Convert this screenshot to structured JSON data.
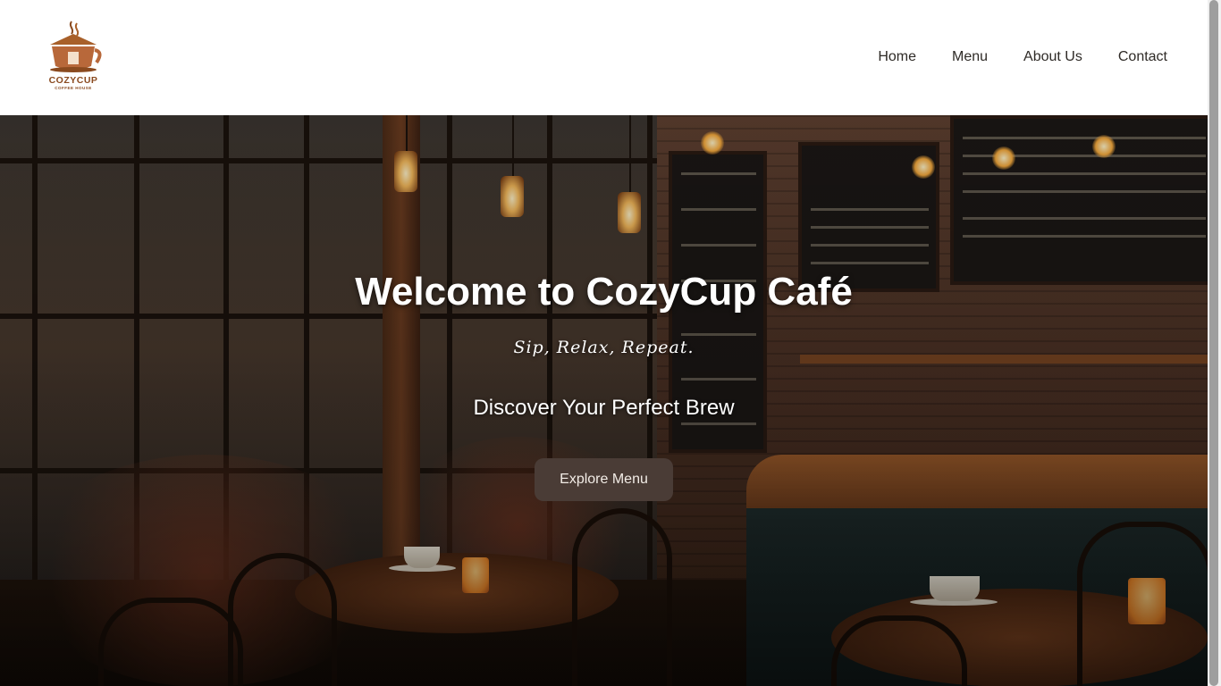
{
  "brand": {
    "name": "COZYCUP",
    "subtitle": "COFFEE HOUSE",
    "accent_color": "#8a4a1f",
    "icon": "coffee-cup-house-logo-icon"
  },
  "nav": {
    "items": [
      {
        "label": "Home"
      },
      {
        "label": "Menu"
      },
      {
        "label": "About Us"
      },
      {
        "label": "Contact"
      }
    ]
  },
  "hero": {
    "title": "Welcome to CozyCup Café",
    "tagline": "Sip, Relax, Repeat.",
    "subtitle": "Discover Your Perfect Brew",
    "cta_label": "Explore Menu",
    "cta_color": "#4a3c36"
  }
}
